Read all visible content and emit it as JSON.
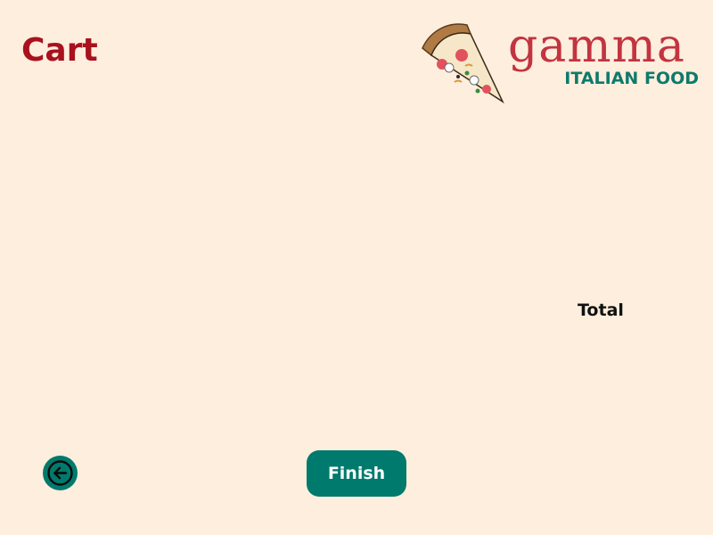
{
  "header": {
    "title": "Cart"
  },
  "brand": {
    "name": "gamma",
    "tagline": "ITALIAN FOOD",
    "logo_icon": "pizza-slice-icon",
    "name_color": "#C23440",
    "tagline_color": "#0E7A6B"
  },
  "summary": {
    "total_label": "Total"
  },
  "actions": {
    "back_icon": "arrow-left-circle-icon",
    "finish_label": "Finish"
  },
  "colors": {
    "background": "#FEEEDD",
    "title": "#A8111E",
    "accent": "#007A6C"
  }
}
